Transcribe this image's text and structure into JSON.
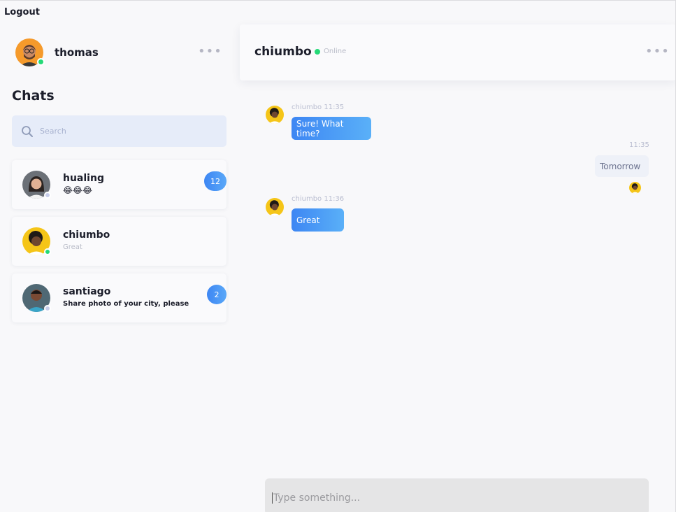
{
  "topbar": {
    "logout_label": "Logout"
  },
  "me": {
    "name": "thomas",
    "status_color": "#24d977"
  },
  "sidebar": {
    "chats_title": "Chats",
    "search_placeholder": "Search",
    "chats": [
      {
        "name": "hualing",
        "preview": "😂😂😂",
        "unread": "12",
        "status_color": "#c7cdea"
      },
      {
        "name": "chiumbo",
        "preview": "Great",
        "unread": "",
        "status_color": "#24d977"
      },
      {
        "name": "santiago",
        "preview": "Share photo of your city, please",
        "unread": "2",
        "status_color": "#c7cdea"
      }
    ]
  },
  "conversation": {
    "contact_name": "chiumbo",
    "status_text": "Online",
    "messages": [
      {
        "direction": "incoming",
        "meta": "chiumbo 11:35",
        "text": "Sure! What time?"
      },
      {
        "direction": "outgoing",
        "meta": "11:35",
        "text": "Tomorrow"
      },
      {
        "direction": "incoming",
        "meta": "chiumbo 11:36",
        "text": "Great"
      }
    ]
  },
  "composer": {
    "placeholder": "Type something..."
  },
  "colors": {
    "accent_start": "#3d86f3",
    "accent_end": "#5ab0f8",
    "online": "#24d977"
  }
}
